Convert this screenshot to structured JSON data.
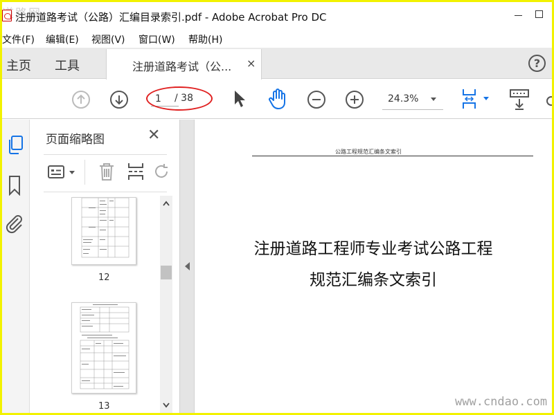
{
  "window": {
    "title": "注册道路考试（公路）汇编目录索引.pdf - Adobe Acrobat Pro DC",
    "watermark_top": "道路网"
  },
  "menu": {
    "items": [
      "文件(F)",
      "编辑(E)",
      "视图(V)",
      "窗口(W)",
      "帮助(H)"
    ]
  },
  "tabs": {
    "home": "主页",
    "tools": "工具",
    "document": "注册道路考试（公...",
    "close": "×"
  },
  "toolbar": {
    "current_page": "1",
    "page_total": "/ 38",
    "zoom": "24.3%",
    "icons": [
      "prev-page-icon",
      "next-page-icon",
      "select-arrow-icon",
      "hand-icon",
      "zoom-out-icon",
      "zoom-in-icon",
      "scroll-mode-icon",
      "keyboard-icon"
    ]
  },
  "panel": {
    "title": "页面缩略图",
    "close": "✕",
    "thumbnails": [
      {
        "label": "12"
      },
      {
        "label": "13"
      }
    ]
  },
  "document": {
    "header": "公路工程规范汇编条文索引",
    "title_line1": "注册道路工程师专业考试公路工程",
    "title_line2": "规范汇编条文索引"
  },
  "watermark_bottom": "www.cndao.com",
  "colors": {
    "frame": "#f2f200",
    "annotation_ellipse": "#e02020",
    "accent_blue": "#1473e6"
  }
}
